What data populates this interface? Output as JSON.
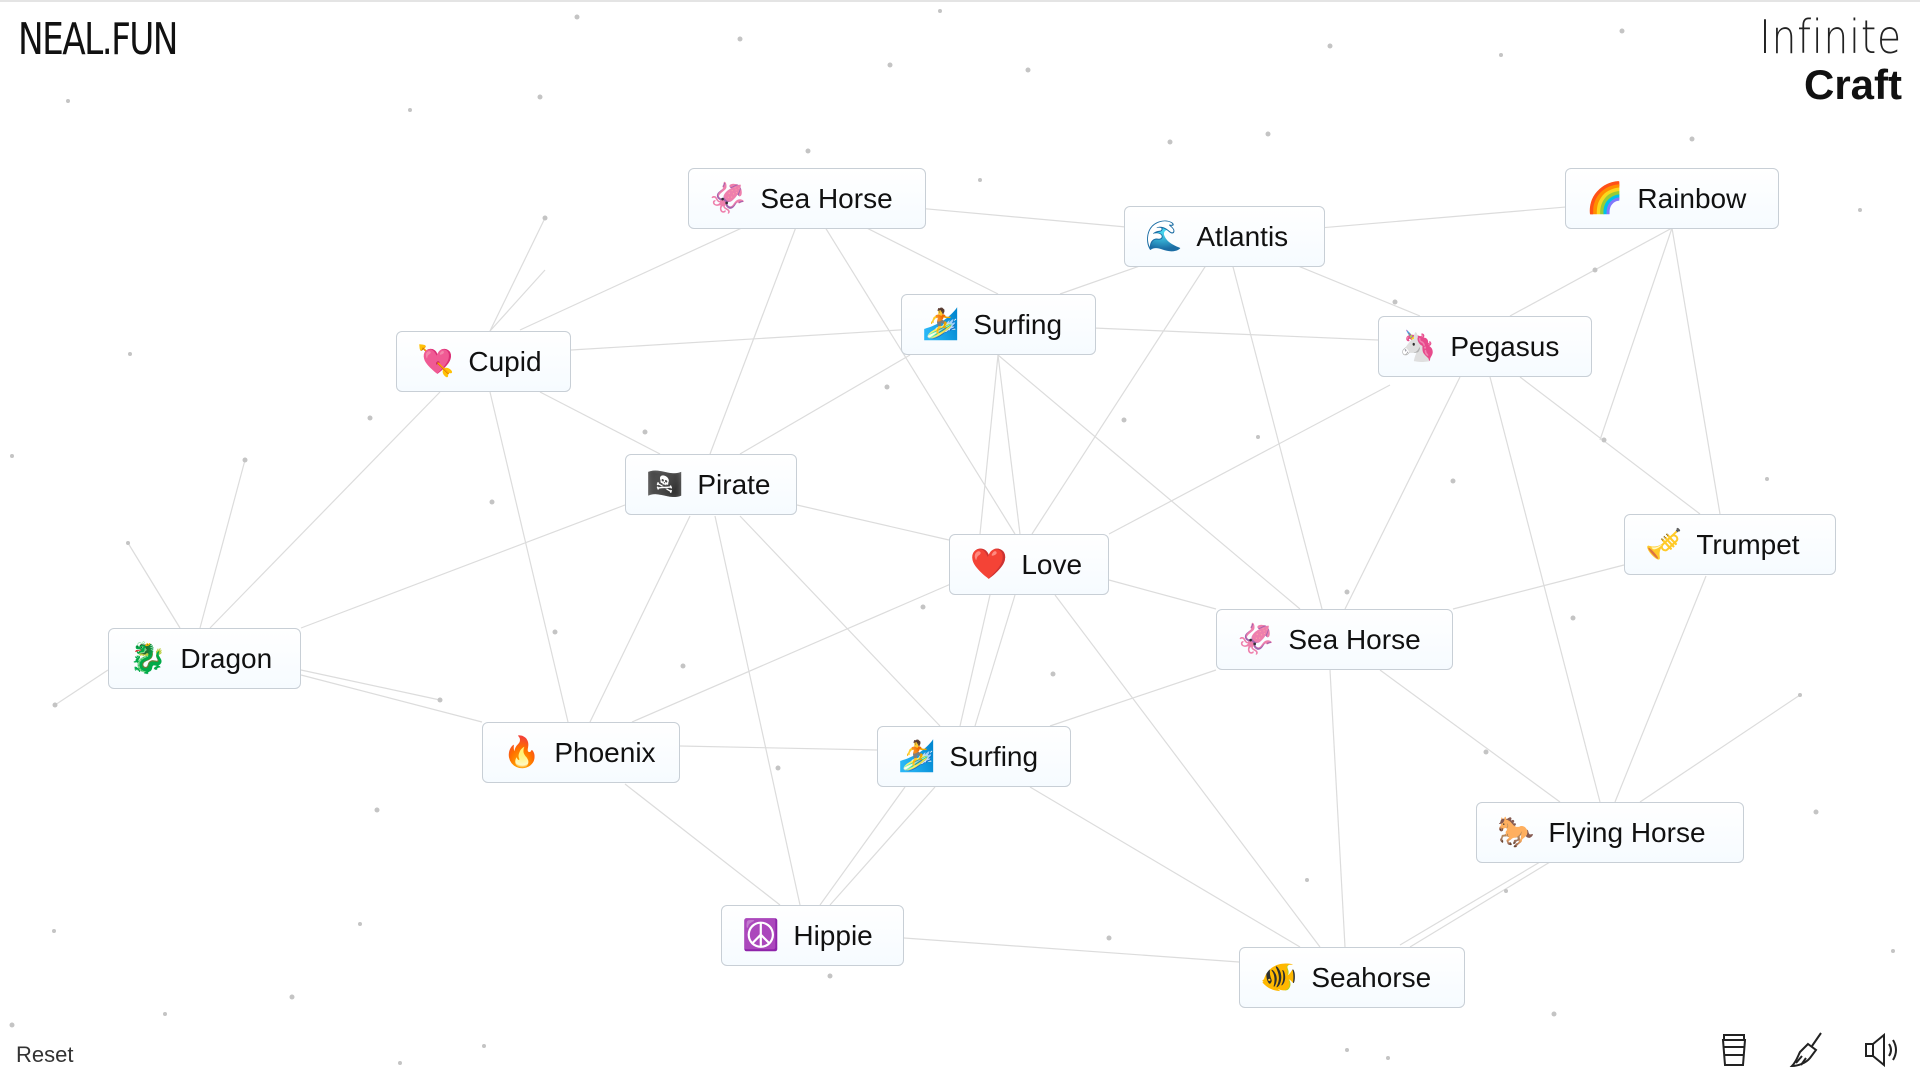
{
  "header": {
    "logo": "NEAL.FUN",
    "title_line1": "Infinite",
    "title_line2": "Craft"
  },
  "elements": [
    {
      "label": "Sea Horse",
      "emoji": "🦑",
      "icon": "squid-icon"
    },
    {
      "label": "Atlantis",
      "emoji": "🌊",
      "icon": "wave-icon"
    },
    {
      "label": "Rainbow",
      "emoji": "🌈",
      "icon": "rainbow-icon"
    },
    {
      "label": "Surfing",
      "emoji": "🏄",
      "icon": "surfer-icon"
    },
    {
      "label": "Cupid",
      "emoji": "💘",
      "icon": "heart-arrow-icon"
    },
    {
      "label": "Pegasus",
      "emoji": "🦄",
      "icon": "unicorn-icon"
    },
    {
      "label": "Pirate",
      "emoji": "🏴‍☠️",
      "icon": "pirate-flag-icon"
    },
    {
      "label": "Love",
      "emoji": "❤️",
      "icon": "heart-icon"
    },
    {
      "label": "Trumpet",
      "emoji": "🎺",
      "icon": "trumpet-icon"
    },
    {
      "label": "Dragon",
      "emoji": "🐉",
      "icon": "dragon-icon"
    },
    {
      "label": "Sea Horse",
      "emoji": "🦑",
      "icon": "squid-icon"
    },
    {
      "label": "Phoenix",
      "emoji": "🔥",
      "icon": "fire-icon"
    },
    {
      "label": "Surfing",
      "emoji": "🏄",
      "icon": "surfer-icon"
    },
    {
      "label": "Flying Horse",
      "emoji": "🐎",
      "icon": "horse-icon"
    },
    {
      "label": "Hippie",
      "emoji": "☮️",
      "icon": "peace-icon"
    },
    {
      "label": "Seahorse",
      "emoji": "🐠",
      "icon": "fish-icon"
    }
  ],
  "footer": {
    "reset_label": "Reset",
    "tools": [
      "coffee-cup-icon",
      "broom-icon",
      "speaker-icon"
    ]
  }
}
